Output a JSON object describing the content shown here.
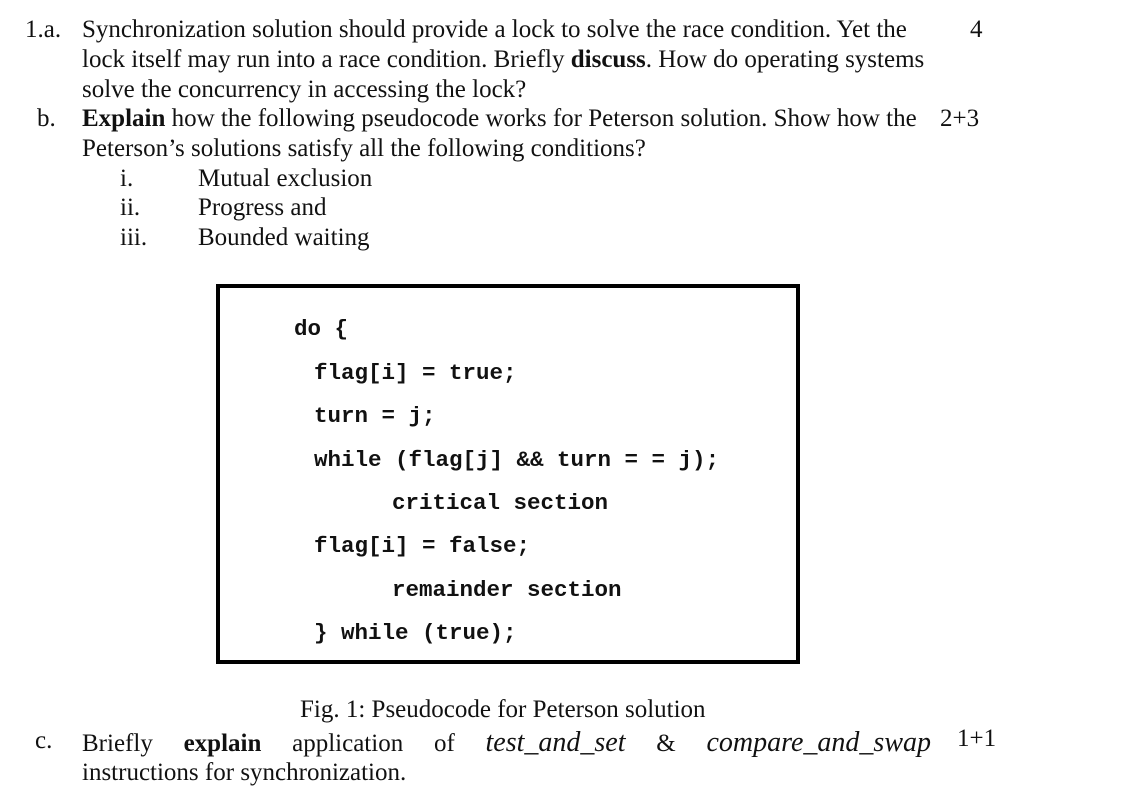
{
  "questions": {
    "q1a": {
      "number": "1.a.",
      "marks": "4",
      "lines": {
        "l1": "Synchronization solution should provide a lock to solve the race condition. Yet the",
        "l2_pre": "lock itself may run into a race condition. Briefly ",
        "l2_bold": "discuss",
        "l2_post": ". How do operating systems",
        "l3": "solve the concurrency in accessing the lock?"
      }
    },
    "q1b": {
      "number": "b.",
      "marks": "2+3",
      "lines": {
        "l1_bold": "Explain",
        "l1_post": " how the following pseudocode works for Peterson solution. Show how the",
        "l2": "Peterson’s solutions satisfy all the following conditions?"
      },
      "conditions": [
        {
          "numeral": "i.",
          "text": "Mutual exclusion"
        },
        {
          "numeral": "ii.",
          "text": "Progress and"
        },
        {
          "numeral": "iii.",
          "text": "Bounded waiting"
        }
      ]
    },
    "figure": {
      "code_lines": [
        "do {",
        "flag[i] = true;",
        "turn = j;",
        "while (flag[j] && turn = = j);",
        "critical section",
        "flag[i] = false;",
        "remainder section",
        "} while (true);"
      ],
      "caption": "Fig. 1: Pseudocode for Peterson solution"
    },
    "q1c": {
      "number": "c.",
      "marks": "1+1",
      "words": {
        "w1": "Briefly",
        "w2_bold": "explain",
        "w3": "application",
        "w4": "of",
        "w5_italic": "test_and_set",
        "w6": "&",
        "w7_italic": "compare_and_swap"
      },
      "l2": "instructions for synchronization."
    }
  }
}
